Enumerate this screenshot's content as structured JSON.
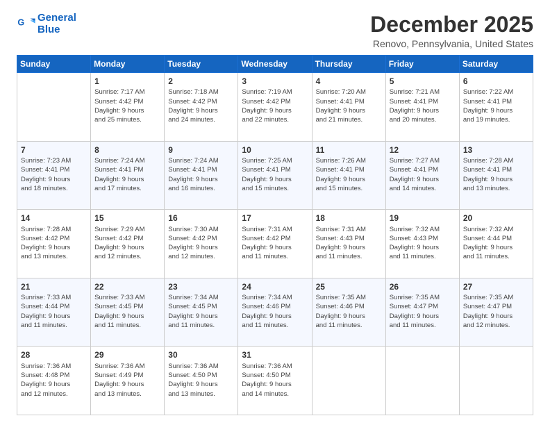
{
  "logo": {
    "line1": "General",
    "line2": "Blue",
    "icon": "🔵"
  },
  "header": {
    "title": "December 2025",
    "subtitle": "Renovo, Pennsylvania, United States"
  },
  "days_of_week": [
    "Sunday",
    "Monday",
    "Tuesday",
    "Wednesday",
    "Thursday",
    "Friday",
    "Saturday"
  ],
  "weeks": [
    [
      {
        "day": "",
        "info": ""
      },
      {
        "day": "1",
        "sunrise": "Sunrise: 7:17 AM",
        "sunset": "Sunset: 4:42 PM",
        "daylight": "Daylight: 9 hours and 25 minutes."
      },
      {
        "day": "2",
        "sunrise": "Sunrise: 7:18 AM",
        "sunset": "Sunset: 4:42 PM",
        "daylight": "Daylight: 9 hours and 24 minutes."
      },
      {
        "day": "3",
        "sunrise": "Sunrise: 7:19 AM",
        "sunset": "Sunset: 4:42 PM",
        "daylight": "Daylight: 9 hours and 22 minutes."
      },
      {
        "day": "4",
        "sunrise": "Sunrise: 7:20 AM",
        "sunset": "Sunset: 4:41 PM",
        "daylight": "Daylight: 9 hours and 21 minutes."
      },
      {
        "day": "5",
        "sunrise": "Sunrise: 7:21 AM",
        "sunset": "Sunset: 4:41 PM",
        "daylight": "Daylight: 9 hours and 20 minutes."
      },
      {
        "day": "6",
        "sunrise": "Sunrise: 7:22 AM",
        "sunset": "Sunset: 4:41 PM",
        "daylight": "Daylight: 9 hours and 19 minutes."
      }
    ],
    [
      {
        "day": "7",
        "sunrise": "Sunrise: 7:23 AM",
        "sunset": "Sunset: 4:41 PM",
        "daylight": "Daylight: 9 hours and 18 minutes."
      },
      {
        "day": "8",
        "sunrise": "Sunrise: 7:24 AM",
        "sunset": "Sunset: 4:41 PM",
        "daylight": "Daylight: 9 hours and 17 minutes."
      },
      {
        "day": "9",
        "sunrise": "Sunrise: 7:24 AM",
        "sunset": "Sunset: 4:41 PM",
        "daylight": "Daylight: 9 hours and 16 minutes."
      },
      {
        "day": "10",
        "sunrise": "Sunrise: 7:25 AM",
        "sunset": "Sunset: 4:41 PM",
        "daylight": "Daylight: 9 hours and 15 minutes."
      },
      {
        "day": "11",
        "sunrise": "Sunrise: 7:26 AM",
        "sunset": "Sunset: 4:41 PM",
        "daylight": "Daylight: 9 hours and 15 minutes."
      },
      {
        "day": "12",
        "sunrise": "Sunrise: 7:27 AM",
        "sunset": "Sunset: 4:41 PM",
        "daylight": "Daylight: 9 hours and 14 minutes."
      },
      {
        "day": "13",
        "sunrise": "Sunrise: 7:28 AM",
        "sunset": "Sunset: 4:41 PM",
        "daylight": "Daylight: 9 hours and 13 minutes."
      }
    ],
    [
      {
        "day": "14",
        "sunrise": "Sunrise: 7:28 AM",
        "sunset": "Sunset: 4:42 PM",
        "daylight": "Daylight: 9 hours and 13 minutes."
      },
      {
        "day": "15",
        "sunrise": "Sunrise: 7:29 AM",
        "sunset": "Sunset: 4:42 PM",
        "daylight": "Daylight: 9 hours and 12 minutes."
      },
      {
        "day": "16",
        "sunrise": "Sunrise: 7:30 AM",
        "sunset": "Sunset: 4:42 PM",
        "daylight": "Daylight: 9 hours and 12 minutes."
      },
      {
        "day": "17",
        "sunrise": "Sunrise: 7:31 AM",
        "sunset": "Sunset: 4:42 PM",
        "daylight": "Daylight: 9 hours and 11 minutes."
      },
      {
        "day": "18",
        "sunrise": "Sunrise: 7:31 AM",
        "sunset": "Sunset: 4:43 PM",
        "daylight": "Daylight: 9 hours and 11 minutes."
      },
      {
        "day": "19",
        "sunrise": "Sunrise: 7:32 AM",
        "sunset": "Sunset: 4:43 PM",
        "daylight": "Daylight: 9 hours and 11 minutes."
      },
      {
        "day": "20",
        "sunrise": "Sunrise: 7:32 AM",
        "sunset": "Sunset: 4:44 PM",
        "daylight": "Daylight: 9 hours and 11 minutes."
      }
    ],
    [
      {
        "day": "21",
        "sunrise": "Sunrise: 7:33 AM",
        "sunset": "Sunset: 4:44 PM",
        "daylight": "Daylight: 9 hours and 11 minutes."
      },
      {
        "day": "22",
        "sunrise": "Sunrise: 7:33 AM",
        "sunset": "Sunset: 4:45 PM",
        "daylight": "Daylight: 9 hours and 11 minutes."
      },
      {
        "day": "23",
        "sunrise": "Sunrise: 7:34 AM",
        "sunset": "Sunset: 4:45 PM",
        "daylight": "Daylight: 9 hours and 11 minutes."
      },
      {
        "day": "24",
        "sunrise": "Sunrise: 7:34 AM",
        "sunset": "Sunset: 4:46 PM",
        "daylight": "Daylight: 9 hours and 11 minutes."
      },
      {
        "day": "25",
        "sunrise": "Sunrise: 7:35 AM",
        "sunset": "Sunset: 4:46 PM",
        "daylight": "Daylight: 9 hours and 11 minutes."
      },
      {
        "day": "26",
        "sunrise": "Sunrise: 7:35 AM",
        "sunset": "Sunset: 4:47 PM",
        "daylight": "Daylight: 9 hours and 11 minutes."
      },
      {
        "day": "27",
        "sunrise": "Sunrise: 7:35 AM",
        "sunset": "Sunset: 4:47 PM",
        "daylight": "Daylight: 9 hours and 12 minutes."
      }
    ],
    [
      {
        "day": "28",
        "sunrise": "Sunrise: 7:36 AM",
        "sunset": "Sunset: 4:48 PM",
        "daylight": "Daylight: 9 hours and 12 minutes."
      },
      {
        "day": "29",
        "sunrise": "Sunrise: 7:36 AM",
        "sunset": "Sunset: 4:49 PM",
        "daylight": "Daylight: 9 hours and 13 minutes."
      },
      {
        "day": "30",
        "sunrise": "Sunrise: 7:36 AM",
        "sunset": "Sunset: 4:50 PM",
        "daylight": "Daylight: 9 hours and 13 minutes."
      },
      {
        "day": "31",
        "sunrise": "Sunrise: 7:36 AM",
        "sunset": "Sunset: 4:50 PM",
        "daylight": "Daylight: 9 hours and 14 minutes."
      },
      {
        "day": "",
        "info": ""
      },
      {
        "day": "",
        "info": ""
      },
      {
        "day": "",
        "info": ""
      }
    ]
  ]
}
